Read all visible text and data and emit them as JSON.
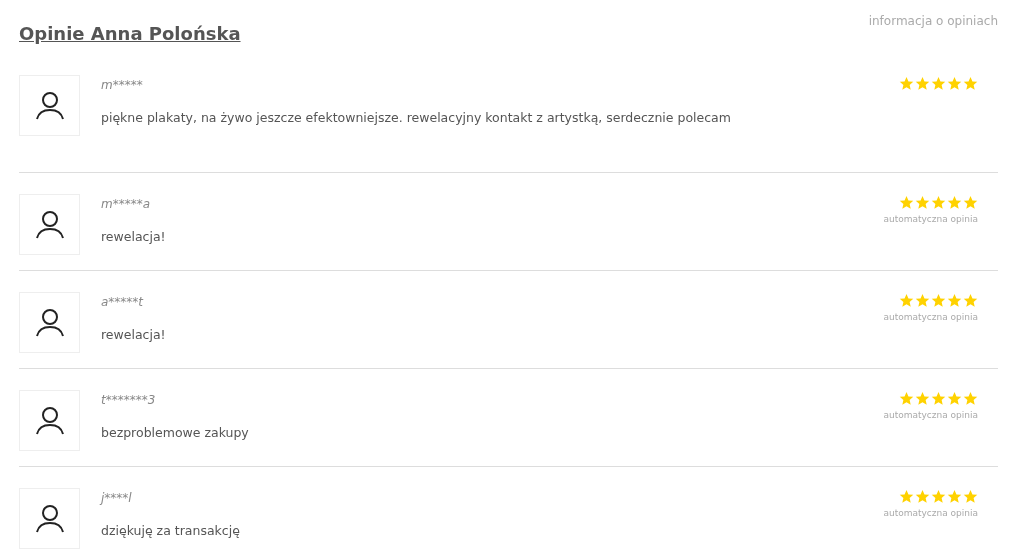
{
  "title": "Opinie Anna Polońska",
  "info_link": "informacja o opiniach",
  "reviews": [
    {
      "user": "m*****",
      "text": "piękne plakaty, na żywo jeszcze efektowniejsze. rewelacyjny kontakt z artystką, serdecznie polecam",
      "stars": 5
    },
    {
      "user": "m*****a",
      "text": "rewelacja!",
      "stars": 5,
      "note": "automatyczna opinia"
    },
    {
      "user": "a*****t",
      "text": "rewelacja!",
      "stars": 5,
      "note": "automatyczna opinia"
    },
    {
      "user": "t*******3",
      "text": "bezproblemowe zakupy",
      "stars": 5,
      "note": "automatyczna opinia"
    },
    {
      "user": "j****l",
      "text": "dziękuję za transakcję",
      "stars": 5,
      "note": "automatyczna opinia"
    }
  ]
}
